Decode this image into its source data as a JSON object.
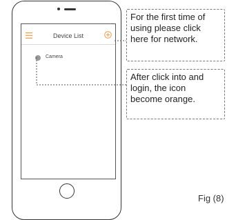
{
  "phone": {
    "screen_title": "Device List",
    "device_name": "Camera"
  },
  "callouts": [
    {
      "lines": [
        "For the first time of",
        "using please click",
        "here for network."
      ]
    },
    {
      "lines": [
        "After click into and",
        "login, the icon",
        "become orange."
      ]
    }
  ],
  "figure_label": "Fig (8)",
  "colors": {
    "accent_orange": "#f0a050",
    "outline": "#333333",
    "divider": "#d8d8d8"
  },
  "icons": {
    "menu": "menu-icon",
    "add": "add-circle-icon",
    "device": "device-avatar-icon"
  }
}
